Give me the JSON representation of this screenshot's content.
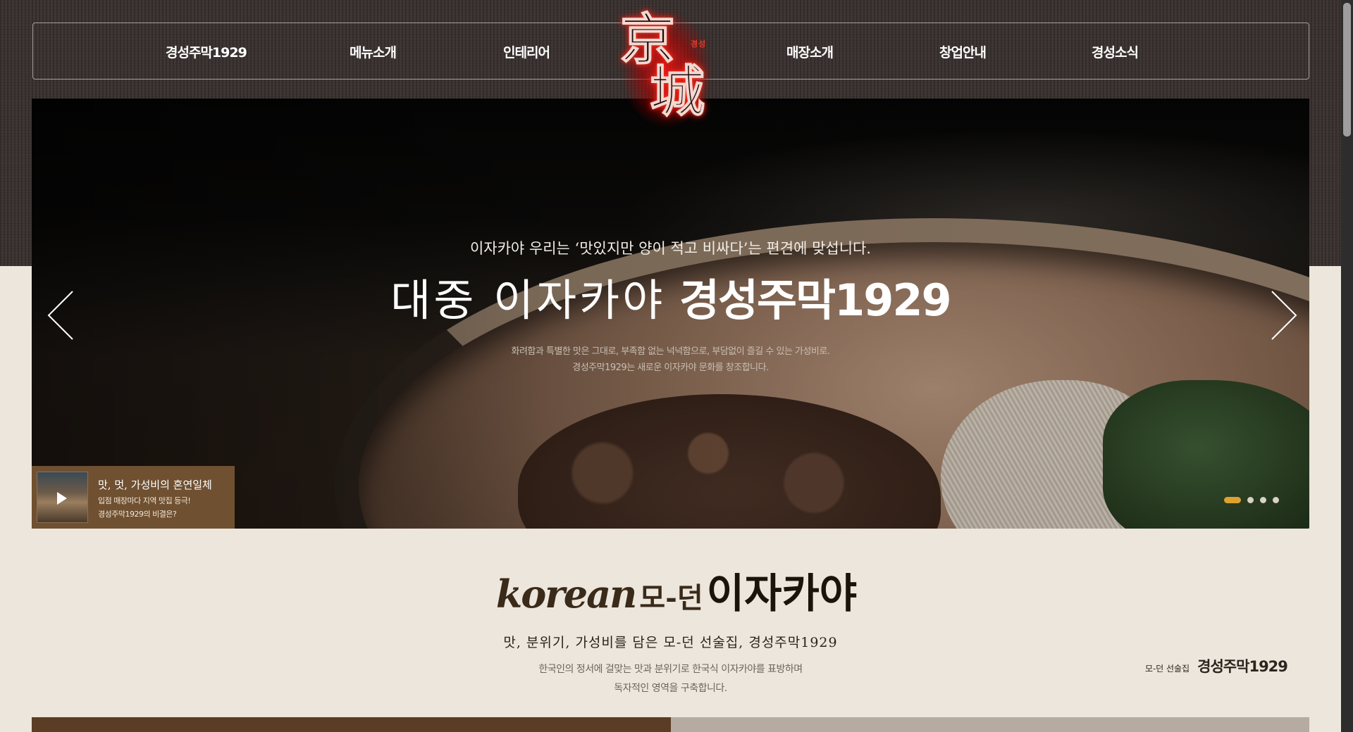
{
  "nav": {
    "items": [
      "경성주막1929",
      "메뉴소개",
      "인테리어",
      "매장소개",
      "창업안내",
      "경성소식"
    ]
  },
  "logo": {
    "char1": "京",
    "char2": "城",
    "tag": "경성"
  },
  "hero": {
    "subtitle": "이자카야 우리는 ‘맛있지만 양이 적고 비싸다’는 편견에 맞섭니다.",
    "title_light": "대중 이자카야",
    "title_bold": "경성주막1929",
    "desc_line1": "화려함과 특별한 맛은 그대로, 부족함 없는 넉넉함으로, 부담없이 즐길 수 있는 가성비로.",
    "desc_line2": "경성주막1929는 새로운 이자카야 문화를 창조합니다.",
    "slide_count": 4,
    "active_slide": 1
  },
  "video": {
    "title": "맛, 멋, 가성비의 혼연일체",
    "line1": "입점 매장마다 지역 맛집 등극!",
    "line2": "경성주막1929의 비결은?"
  },
  "intro": {
    "heading_en": "korean",
    "heading_mid": "모-던",
    "heading_kr": "이자카야",
    "subtitle": "맛, 분위기, 가성비를 담은 모-던 선술집, 경성주막1929",
    "desc_line1": "한국인의 정서에 걸맞는 맛과 분위기로 한국식 이자카야를 표방하며",
    "desc_line2": "독자적인 영역을 구축합니다."
  },
  "side_brand": {
    "small": "모-던 선술집",
    "big": "경성주막1929"
  },
  "colors": {
    "top_band": "#3b3331",
    "page_bg": "#ece6dc",
    "video_box": "#6f5031",
    "active_dot": "#e0a030",
    "logo_glow": "#e61414"
  },
  "icons": [
    "chevron-left-icon",
    "chevron-right-icon",
    "play-icon"
  ]
}
